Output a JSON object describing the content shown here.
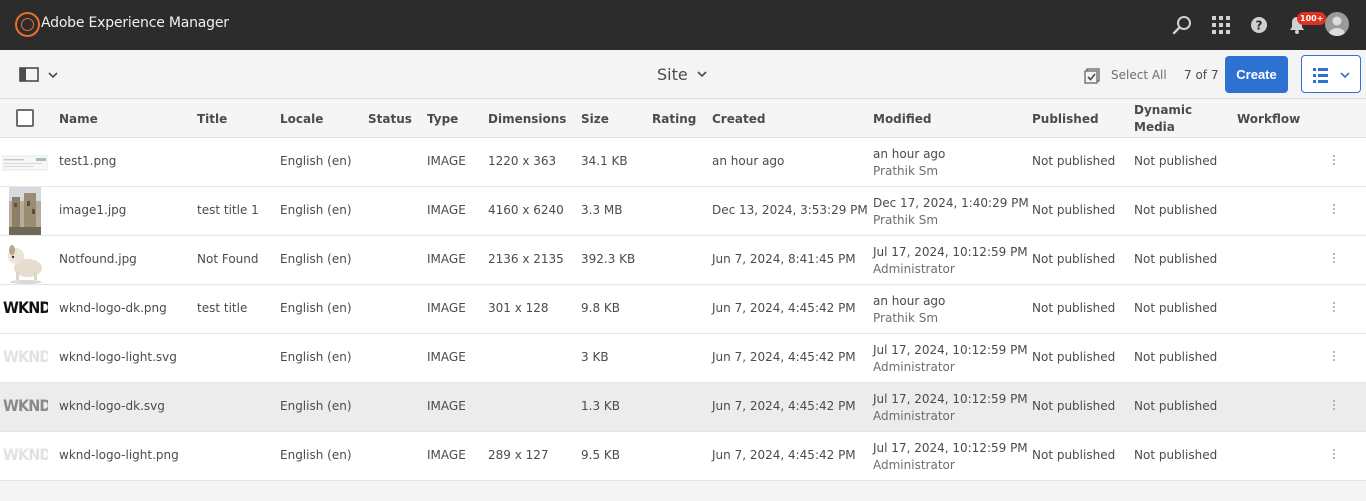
{
  "shell": {
    "app_title": "Adobe Experience Manager",
    "notification_count": "100+"
  },
  "actionbar": {
    "context_title": "Site",
    "select_all_label": "Select All",
    "count_label": "7 of 7",
    "create_label": "Create"
  },
  "columns": {
    "name": "Name",
    "title": "Title",
    "locale": "Locale",
    "status": "Status",
    "type": "Type",
    "dimensions": "Dimensions",
    "size": "Size",
    "rating": "Rating",
    "created": "Created",
    "modified": "Modified",
    "published": "Published",
    "dynamic_media_line1": "Dynamic",
    "dynamic_media_line2": "Media",
    "workflow": "Workflow"
  },
  "rows": [
    {
      "name": "test1.png",
      "title": "",
      "locale": "English (en)",
      "type": "IMAGE",
      "dimensions": "1220 x 363",
      "size": "34.1 KB",
      "created": "an hour ago",
      "modified": "an hour ago",
      "modified_by": "Prathik Sm",
      "published": "Not published",
      "dynamic_media": "Not published",
      "thumb": "screenshot-thumbnail"
    },
    {
      "name": "image1.jpg",
      "title": "test title 1",
      "locale": "English (en)",
      "type": "IMAGE",
      "dimensions": "4160 x 6240",
      "size": "3.3 MB",
      "created": "Dec 13, 2024, 3:53:29 PM",
      "modified": "Dec 17, 2024, 1:40:29 PM",
      "modified_by": "Prathik Sm",
      "published": "Not published",
      "dynamic_media": "Not published",
      "thumb": "building-photo-thumbnail"
    },
    {
      "name": "Notfound.jpg",
      "title": "Not Found",
      "locale": "English (en)",
      "type": "IMAGE",
      "dimensions": "2136 x 2135",
      "size": "392.3 KB",
      "created": "Jun 7, 2024, 8:41:45 PM",
      "modified": "Jul 17, 2024, 10:12:59 PM",
      "modified_by": "Administrator",
      "published": "Not published",
      "dynamic_media": "Not published",
      "thumb": "dog-photo-thumbnail"
    },
    {
      "name": "wknd-logo-dk.png",
      "title": "test title",
      "locale": "English (en)",
      "type": "IMAGE",
      "dimensions": "301 x 128",
      "size": "9.8 KB",
      "created": "Jun 7, 2024, 4:45:42 PM",
      "modified": "an hour ago",
      "modified_by": "Prathik Sm",
      "published": "Not published",
      "dynamic_media": "Not published",
      "thumb": "wknd-dark-logo",
      "logo_text": "WKND",
      "logo_color": "#111111"
    },
    {
      "name": "wknd-logo-light.svg",
      "title": "",
      "locale": "English (en)",
      "type": "IMAGE",
      "dimensions": "",
      "size": "3 KB",
      "created": "Jun 7, 2024, 4:45:42 PM",
      "modified": "Jul 17, 2024, 10:12:59 PM",
      "modified_by": "Administrator",
      "published": "Not published",
      "dynamic_media": "Not published",
      "thumb": "wknd-light-logo",
      "logo_text": "WKND",
      "logo_color": "#e2e2e2"
    },
    {
      "name": "wknd-logo-dk.svg",
      "title": "",
      "locale": "English (en)",
      "type": "IMAGE",
      "dimensions": "",
      "size": "1.3 KB",
      "created": "Jun 7, 2024, 4:45:42 PM",
      "modified": "Jul 17, 2024, 10:12:59 PM",
      "modified_by": "Administrator",
      "published": "Not published",
      "dynamic_media": "Not published",
      "thumb": "wknd-dark-logo",
      "logo_text": "WKND",
      "logo_color": "#8a8a8a"
    },
    {
      "name": "wknd-logo-light.png",
      "title": "",
      "locale": "English (en)",
      "type": "IMAGE",
      "dimensions": "289 x 127",
      "size": "9.5 KB",
      "created": "Jun 7, 2024, 4:45:42 PM",
      "modified": "Jul 17, 2024, 10:12:59 PM",
      "modified_by": "Administrator",
      "published": "Not published",
      "dynamic_media": "Not published",
      "thumb": "wknd-light-logo",
      "logo_text": "WKND",
      "logo_color": "#e2e2e2"
    }
  ],
  "colors": {
    "shell_bg": "#2c2c2c",
    "accent": "#2d72d2",
    "logo_orange": "#e8702a",
    "badge_red": "#e0301e"
  }
}
